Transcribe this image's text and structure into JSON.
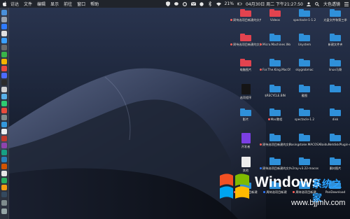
{
  "menubar": {
    "items": [
      "访达",
      "文件",
      "编辑",
      "显示",
      "前往",
      "窗口",
      "帮助"
    ],
    "clock": "04月30日 周二 下午21:27:50",
    "battery": "21%",
    "input_method": "大色透镜"
  },
  "desktop": {
    "col1": [
      {
        "label": "周待选项目新建的文件夹 5",
        "tag": "#ff5f57",
        "type": "folder-red"
      },
      {
        "label": "周待选项目新建的文件夹 4",
        "tag": "#ff5f57",
        "type": "folder-red"
      },
      {
        "label": "电脑图片",
        "tag": "",
        "type": "folder-red"
      },
      {
        "label": "选项程序",
        "tag": "",
        "type": "app-dark"
      },
      {
        "label": "影片",
        "tag": "",
        "type": "folder-blue"
      },
      {
        "label": "开发者",
        "tag": "",
        "type": "app-purple"
      },
      {
        "label": "其他",
        "tag": "",
        "type": "app-white"
      },
      {
        "label": "周待选项目新建",
        "tag": "#ff5f57",
        "type": "folder-blue"
      }
    ],
    "col2": [
      {
        "label": "Videos",
        "tag": "",
        "type": "folder-red"
      },
      {
        "label": "Micro.Machines.Worl...IVATED",
        "tag": "#ff5f57",
        "type": "folder-blue"
      },
      {
        "label": "For.The.King.MacOS...IVATED",
        "tag": "#ff5f57",
        "type": "folder-blue"
      },
      {
        "label": "$RECYCLE.BIN",
        "tag": "",
        "type": "folder-blue"
      },
      {
        "label": "Mac教程",
        "tag": "#ff5f57",
        "type": "folder-blue"
      },
      {
        "label": "周待选项目新建的文件夹 8",
        "tag": "#ff5f57",
        "type": "folder-blue"
      },
      {
        "label": "周待选项目新建的文件夹 7",
        "tag": "#2f7bff",
        "type": "folder-blue"
      },
      {
        "label": "周待选项目新建",
        "tag": "#2f7bff",
        "type": "folder-blue"
      }
    ],
    "col3": [
      {
        "label": "spectacle-1-1.2",
        "tag": "",
        "type": "folder-blue"
      },
      {
        "label": "Usystem",
        "tag": "",
        "type": "folder-blue"
      },
      {
        "label": "skygrobmac",
        "tag": "",
        "type": "folder-blue"
      },
      {
        "label": "截图",
        "tag": "",
        "type": "folder-blue"
      },
      {
        "label": "spectacle-1.2",
        "tag": "",
        "type": "folder-blue"
      },
      {
        "label": "Basingstoke.MACOSX-GOG",
        "tag": "",
        "type": "folder-blue"
      },
      {
        "label": "v2ray-v3.22-macos",
        "tag": "",
        "type": "folder-blue"
      },
      {
        "label": "周待选项目新建",
        "tag": "#ff5f57",
        "type": "folder-blue"
      }
    ],
    "col4": [
      {
        "label": "光盘文件和第三季",
        "tag": "",
        "type": "folder-blue"
      },
      {
        "label": "新建文件夹",
        "tag": "",
        "type": "folder-blue"
      },
      {
        "label": "linux马哥",
        "tag": "",
        "type": "folder-blue"
      },
      {
        "label": "",
        "tag": "",
        "type": "folder-blue"
      },
      {
        "label": "disk",
        "tag": "",
        "type": "folder-blue"
      },
      {
        "label": "BaiduNetdiskPlugin-ma...-master",
        "tag": "",
        "type": "folder-blue"
      },
      {
        "label": "素材图片",
        "tag": "",
        "type": "folder-blue"
      },
      {
        "label": "PanDownload",
        "tag": "",
        "type": "folder-blue"
      }
    ]
  },
  "watermark": {
    "title": "Windows",
    "subtitle": "系统之家",
    "url": "www.bjjmlv.com"
  },
  "colors": {
    "folder_blue": "#2f90d9",
    "folder_red": "#e2434f",
    "menubar": "#20242b"
  }
}
